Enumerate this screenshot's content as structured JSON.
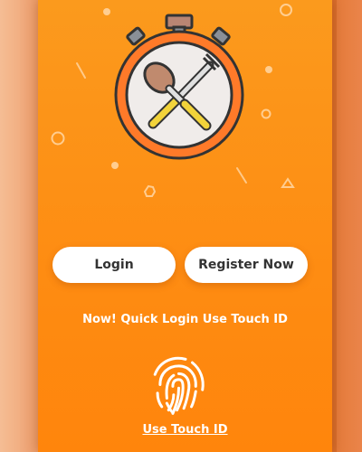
{
  "buttons": {
    "login": "Login",
    "register": "Register Now"
  },
  "quick_login_text": "Now! Quick Login Use Touch ID",
  "touch_id_link": "Use Touch ID",
  "icons": {
    "hero": "stopwatch-utensils-icon",
    "fingerprint": "fingerprint-icon"
  },
  "colors": {
    "card_top": "#fb9a1d",
    "card_bottom": "#ff850c",
    "button_bg": "#ffffff",
    "button_text": "#333333",
    "text_light": "#ffffff"
  }
}
